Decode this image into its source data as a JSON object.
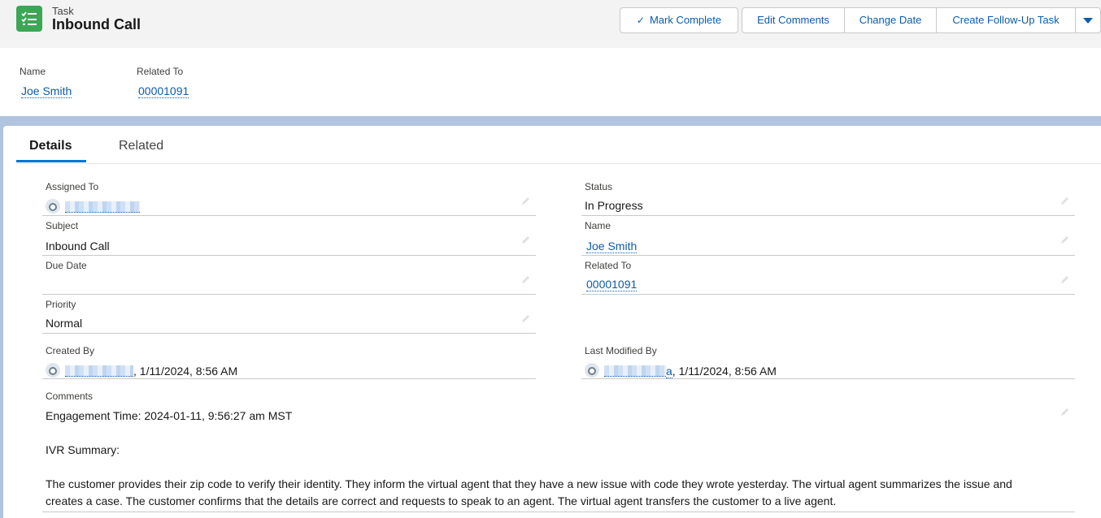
{
  "header": {
    "object_type": "Task",
    "title": "Inbound Call",
    "icon": "task-icon",
    "actions": {
      "mark_complete": "Mark Complete",
      "edit_comments": "Edit Comments",
      "change_date": "Change Date",
      "create_follow_up": "Create Follow-Up Task"
    },
    "highlights": {
      "name_label": "Name",
      "name_value": "Joe Smith",
      "related_label": "Related To",
      "related_value": "00001091"
    }
  },
  "tabs": {
    "details": "Details",
    "related": "Related"
  },
  "details": {
    "assigned_to_label": "Assigned To",
    "status_label": "Status",
    "status_value": "In Progress",
    "subject_label": "Subject",
    "subject_value": "Inbound Call",
    "name_label": "Name",
    "name_value": "Joe Smith",
    "due_date_label": "Due Date",
    "due_date_value": "",
    "related_label": "Related To",
    "related_value": "00001091",
    "priority_label": "Priority",
    "priority_value": "Normal",
    "created_by_label": "Created By",
    "created_by_date": ", 1/11/2024, 8:56 AM",
    "modified_by_label": "Last Modified By",
    "modified_by_date": ", 1/11/2024, 8:56 AM",
    "modified_by_suffix": "a",
    "comments_label": "Comments",
    "comments_lines": [
      "Engagement Time: 2024-01-11, 9:56:27 am MST",
      "IVR Summary:",
      "The customer provides their zip code to verify their identity. They inform the virtual agent that they have a new issue with code they wrote yesterday. The virtual agent summarizes the issue and",
      "creates a case. The customer confirms that the details are correct and requests to speak to an agent. The virtual agent transfers the customer to a live agent."
    ]
  },
  "colors": {
    "brand_link": "#0b5cab",
    "task_icon": "#3ba755",
    "tab_active": "#0176d3"
  }
}
